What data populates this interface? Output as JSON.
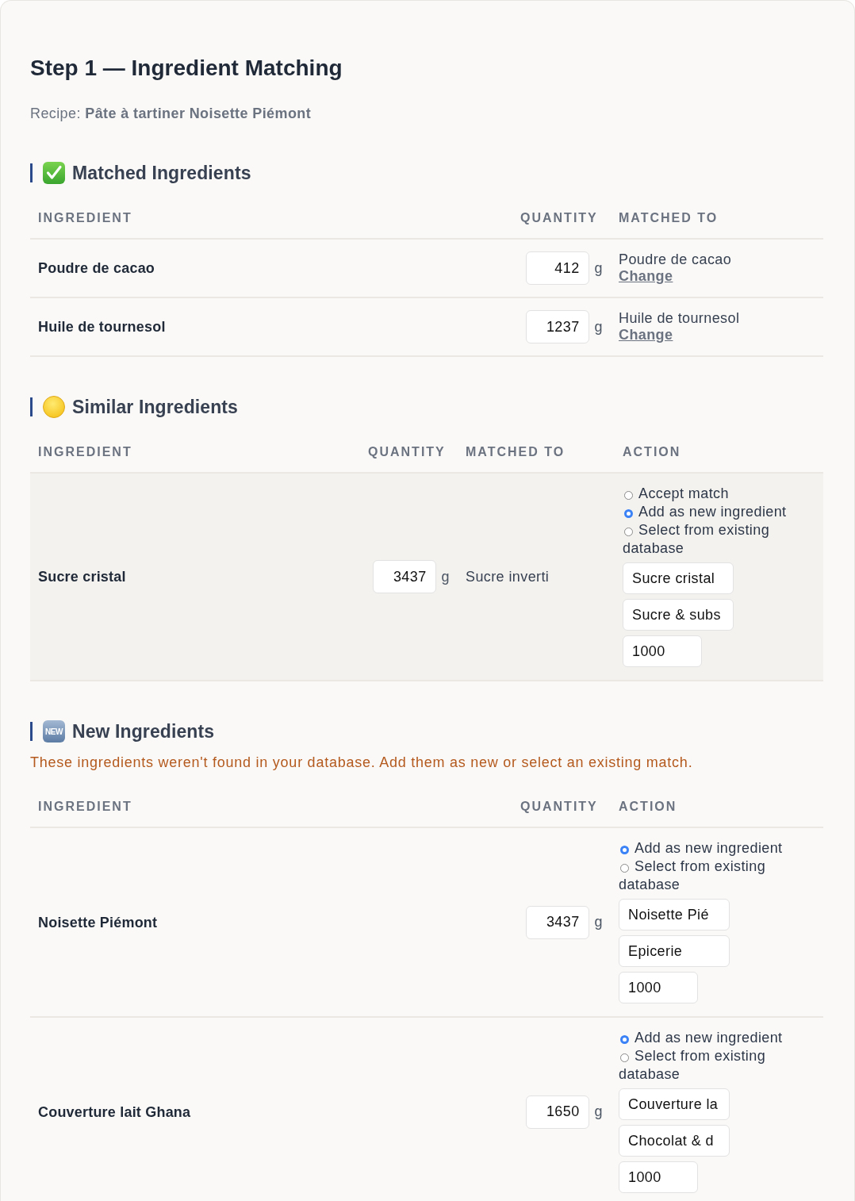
{
  "title": "Step 1 — Ingredient Matching",
  "recipe": "Recipe: **Pâte à tartiner Noisette Piémont**",
  "sections": [
    {
      "kind": "matched",
      "title": "Matched Ingredients",
      "columns": [
        "INGREDIENT",
        "QUANTITY",
        "MATCHED TO"
      ],
      "rows": [
        {
          "ingredient": "Poudre de cacao",
          "quantity": "412",
          "unit": "g",
          "matched_to": "Poudre de cacao",
          "link": "Change"
        },
        {
          "ingredient": "Huile de tournesol",
          "quantity": "1237",
          "unit": "g",
          "matched_to": "Huile de tournesol",
          "link": "Change"
        }
      ]
    },
    {
      "kind": "similar",
      "title": "Similar Ingredients",
      "columns": [
        "INGREDIENT",
        "QUANTITY",
        "MATCHED TO",
        "ACTION"
      ],
      "rows": [
        {
          "ingredient": "Sucre cristal",
          "quantity": "3437",
          "unit": "g",
          "matched_to": "Sucre inverti",
          "options": [
            {
              "label": "Accept match",
              "selected": false
            },
            {
              "label": "Add as new ingredient",
              "selected": true
            },
            {
              "label": "Select from existing database",
              "selected": false
            }
          ],
          "fields": [
            {
              "kind": "text",
              "value": "Sucre cristal"
            },
            {
              "kind": "text",
              "value": "Sucre & subs"
            },
            {
              "kind": "number",
              "value": "1000"
            }
          ]
        }
      ]
    },
    {
      "kind": "new",
      "title": "New Ingredients",
      "badge": "NEW",
      "description": "These ingredients weren't found in your database. Add them as new or select an existing match.",
      "columns": [
        "INGREDIENT",
        "QUANTITY",
        "ACTION"
      ],
      "rows": [
        {
          "ingredient": "Noisette Piémont",
          "quantity": "3437",
          "unit": "g",
          "options": [
            {
              "label": "Add as new ingredient",
              "selected": true
            },
            {
              "label": "Select from existing database",
              "selected": false
            }
          ],
          "fields": [
            {
              "kind": "text",
              "value": "Noisette Pié"
            },
            {
              "kind": "text",
              "value": "Epicerie"
            },
            {
              "kind": "number",
              "value": "1000"
            }
          ]
        },
        {
          "ingredient": "Couverture lait Ghana",
          "quantity": "1650",
          "unit": "g",
          "options": [
            {
              "label": "Add as new ingredient",
              "selected": true
            },
            {
              "label": "Select from existing database",
              "selected": false
            }
          ],
          "fields": [
            {
              "kind": "text",
              "value": "Couverture la"
            },
            {
              "kind": "text",
              "value": "Chocolat & d"
            },
            {
              "kind": "number",
              "value": "1000"
            }
          ]
        }
      ]
    }
  ]
}
